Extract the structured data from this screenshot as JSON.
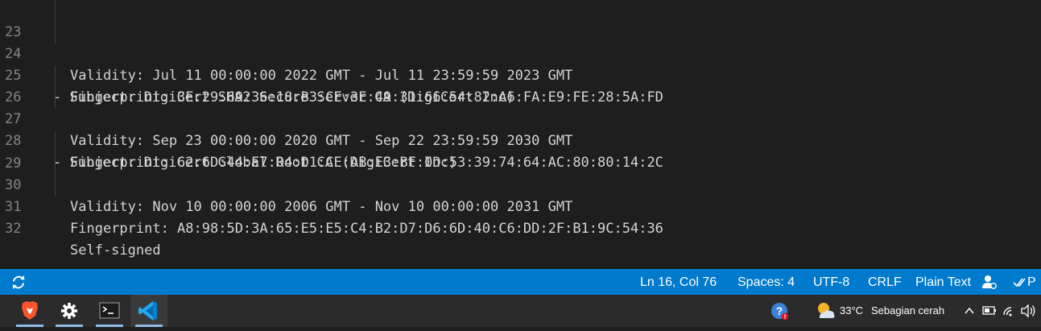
{
  "editor": {
    "lines": [
      {
        "num": "23",
        "text": "Validity: Jul 11 00:00:00 2022 GMT - Jul 11 23:59:59 2023 GMT",
        "indent": true
      },
      {
        "num": "24",
        "text": "Fingerprint: 3E:29:69:36:18:B3:CE:3E:49:31:66:54:82:A6:FA:E9:FE:28:5A:FD",
        "indent": true
      },
      {
        "num": "25",
        "text": "- Subject: DigiCert SHA2 Secure Server CA (DigiCert Inc)",
        "indent": false
      },
      {
        "num": "26",
        "text": "Validity: Sep 23 00:00:00 2020 GMT - Sep 22 23:59:59 2030 GMT",
        "indent": true
      },
      {
        "num": "27",
        "text": "Fingerprint: 62:6D:44:E7:04:D1:CE:AB:E3:BF:0D:53:39:74:64:AC:80:80:14:2C",
        "indent": true
      },
      {
        "num": "28",
        "text": "- Subject: DigiCert Global Root CA (DigiCert Inc)",
        "indent": false
      },
      {
        "num": "29",
        "text": "Validity: Nov 10 00:00:00 2006 GMT - Nov 10 00:00:00 2031 GMT",
        "indent": true
      },
      {
        "num": "30",
        "text": "Fingerprint: A8:98:5D:3A:65:E5:E5:C4:B2:D7:D6:6D:40:C6:DD:2F:B1:9C:54:36",
        "indent": true
      },
      {
        "num": "31",
        "text": "Self-signed",
        "indent": true
      },
      {
        "num": "32",
        "text": "",
        "indent": false
      }
    ]
  },
  "statusbar": {
    "sync_icon": "sync-icon",
    "cursor_position": "Ln 16, Col 76",
    "indentation": "Spaces: 4",
    "encoding": "UTF-8",
    "eol": "CRLF",
    "language": "Plain Text",
    "feedback_icon": "person-feedback-icon",
    "prettier_label": "P",
    "color": "#007acc"
  },
  "taskbar": {
    "apps": [
      {
        "name": "brave-browser",
        "icon": "brave-lion-icon"
      },
      {
        "name": "settings",
        "icon": "gear-icon"
      },
      {
        "name": "terminal",
        "icon": "terminal-icon"
      },
      {
        "name": "vscode",
        "icon": "vscode-icon",
        "active": true
      }
    ],
    "tray": {
      "help_icon": "help-icon",
      "weather_icon": "partly-cloudy-icon",
      "temperature": "33°C",
      "weather_text": "Sebagian cerah",
      "chevron_icon": "chevron-up-icon",
      "battery_icon": "battery-icon",
      "wifi_icon": "wifi-icon",
      "volume_icon": "volume-icon"
    }
  }
}
